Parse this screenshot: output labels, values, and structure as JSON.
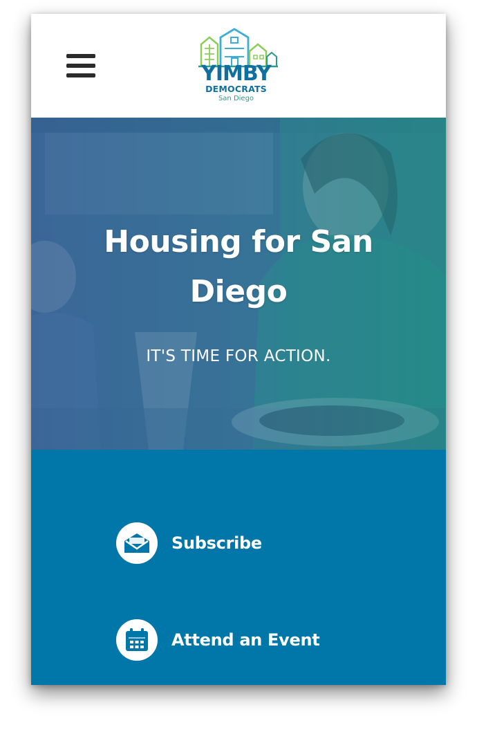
{
  "header": {
    "menu_icon": "hamburger-menu-icon",
    "logo": {
      "word": "YIMBY",
      "sub": "DEMOCRATS",
      "city": "San Diego",
      "colors": {
        "primary": "#0f6f9e",
        "green": "#8ccc5a",
        "teal": "#2a9a8e",
        "sky": "#3aaed8"
      }
    }
  },
  "hero": {
    "title": "Housing for San Diego",
    "tagline": "IT'S TIME FOR ACTION."
  },
  "actions": [
    {
      "label": "Subscribe",
      "icon": "envelope-icon"
    },
    {
      "label": "Attend an Event",
      "icon": "calendar-icon"
    }
  ],
  "colors": {
    "action_band": "#0077a8",
    "text_on_dark": "#ffffff"
  }
}
